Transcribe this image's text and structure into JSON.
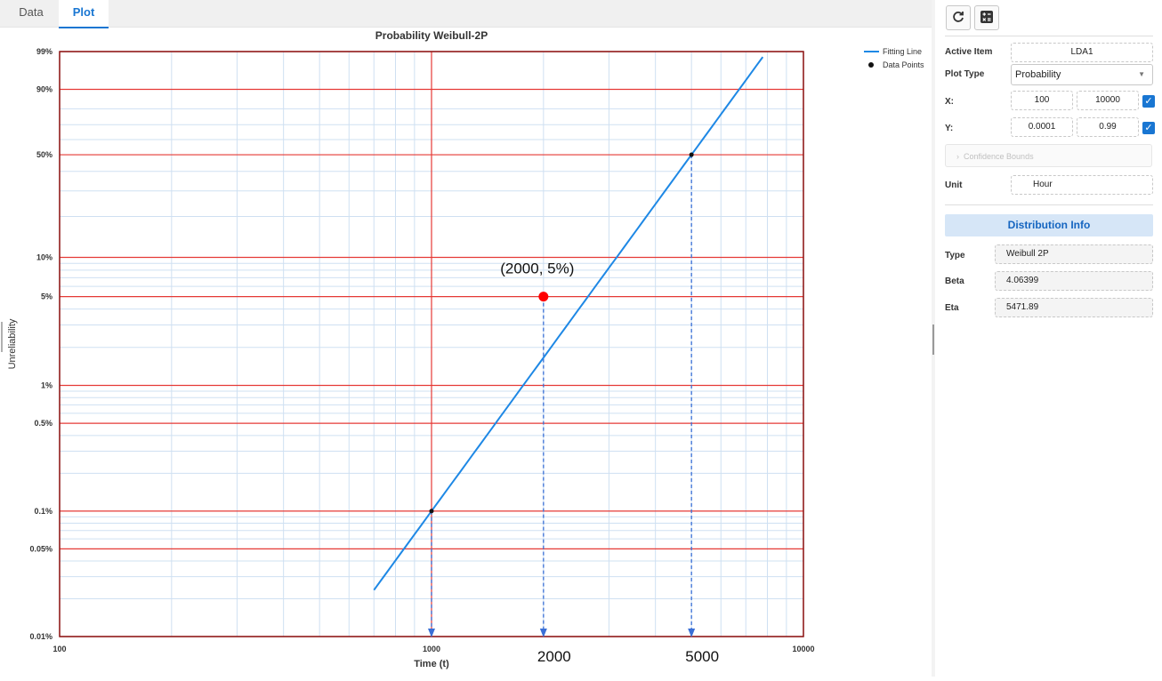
{
  "tabs": [
    {
      "label": "Data"
    },
    {
      "label": "Plot"
    }
  ],
  "panel": {
    "active_item_label": "Active Item",
    "active_item_value": "LDA1",
    "plot_type_label": "Plot Type",
    "plot_type_value": "Probability",
    "x_label": "X:",
    "x_min": "100",
    "x_max": "10000",
    "y_label": "Y:",
    "y_min": "0.0001",
    "y_max": "0.99",
    "confidence_label": "Confidence Bounds",
    "unit_label": "Unit",
    "unit_value": "Hour",
    "dist_header": "Distribution Info",
    "type_label": "Type",
    "type_value": "Weibull 2P",
    "beta_label": "Beta",
    "beta_value": "4.06399",
    "eta_label": "Eta",
    "eta_value": "5471.89",
    "icons": {
      "refresh": "refresh-icon",
      "calculator": "calculator-icon",
      "dropdown": "caret-down-icon",
      "chevron": "chevron-right-icon",
      "check": "check-icon"
    }
  },
  "colors": {
    "accent": "#1976d2",
    "fit_line": "#1e88e5",
    "major_grid": "#e53935",
    "minor_grid": "#cfe0f2",
    "marker": "#ff0000",
    "arrow": "#3a6fd6"
  },
  "chart_data": {
    "type": "line",
    "title": "Probability Weibull-2P",
    "xlabel": "Time (t)",
    "ylabel": "Unreliability",
    "x_scale": "log",
    "y_scale": "weibull",
    "xlim": [
      100,
      10000
    ],
    "ylim": [
      0.0001,
      0.99
    ],
    "x_ticks": [
      {
        "value": 100,
        "label": "100"
      },
      {
        "value": 1000,
        "label": "1000"
      },
      {
        "value": 10000,
        "label": "10000"
      }
    ],
    "y_ticks": [
      {
        "value": 0.99,
        "label": "99%"
      },
      {
        "value": 0.9,
        "label": "90%"
      },
      {
        "value": 0.5,
        "label": "50%"
      },
      {
        "value": 0.1,
        "label": "10%"
      },
      {
        "value": 0.05,
        "label": "5%"
      },
      {
        "value": 0.01,
        "label": "1%"
      },
      {
        "value": 0.005,
        "label": "0.5%"
      },
      {
        "value": 0.001,
        "label": "0.1%"
      },
      {
        "value": 0.0005,
        "label": "0.05%"
      },
      {
        "value": 0.0001,
        "label": "0.01%"
      }
    ],
    "y_minor": [
      0.8,
      0.7,
      0.6,
      0.4,
      0.3,
      0.2,
      0.09,
      0.08,
      0.07,
      0.06,
      0.04,
      0.03,
      0.02,
      0.009,
      0.008,
      0.007,
      0.006,
      0.004,
      0.003,
      0.002,
      0.0009,
      0.0008,
      0.0007,
      0.0006,
      0.0004,
      0.0003,
      0.0002
    ],
    "series": [
      {
        "name": "Fitting Line",
        "kind": "line",
        "beta": 4.06399,
        "eta": 5471.89,
        "x_range": [
          700,
          8100
        ]
      },
      {
        "name": "Data Points",
        "kind": "points",
        "points": [
          {
            "x": 1000,
            "y": 0.001
          },
          {
            "x": 5000,
            "y": 0.5
          }
        ]
      }
    ],
    "annotations": [
      {
        "x": 2000,
        "y": 0.05,
        "label": "(2000, 5%)",
        "kind": "highlight"
      },
      {
        "x": 1000,
        "y": 0.001,
        "label": "",
        "kind": "drop"
      },
      {
        "x": 2000,
        "y": 0.05,
        "label": "2000",
        "kind": "drop"
      },
      {
        "x": 5000,
        "y": 0.5,
        "label": "5000",
        "kind": "drop"
      }
    ],
    "legend": {
      "position": "top-right",
      "entries": [
        "Fitting Line",
        "Data Points"
      ]
    }
  }
}
